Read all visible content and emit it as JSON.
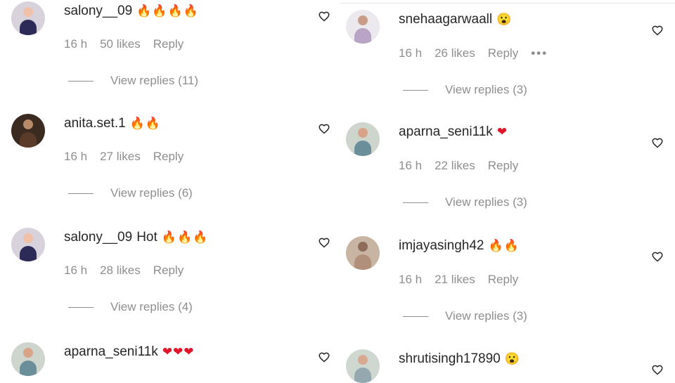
{
  "colors": {
    "username": "#262626",
    "meta": "#8e8e8e",
    "fire": "#ff6a00",
    "heart": "#e0162b",
    "emoji_face": "#f4b400"
  },
  "left_comments": [
    {
      "user": "salony__09",
      "text": "",
      "emoji": "🔥🔥🔥🔥",
      "emoji_type": "fire",
      "time": "16 h",
      "likes": "50 likes",
      "reply": "Reply",
      "view_replies": "View replies (11)",
      "avatar_colors": [
        "#d7d2dc",
        "#f0c0a8",
        "#2c2b58"
      ]
    },
    {
      "user": "anita.set.1",
      "text": "",
      "emoji": "🔥🔥",
      "emoji_type": "fire",
      "time": "16 h",
      "likes": "27 likes",
      "reply": "Reply",
      "view_replies": "View replies (6)",
      "avatar_colors": [
        "#3a2a20",
        "#b88a6a",
        "#5a3b2a"
      ]
    },
    {
      "user": "salony__09",
      "text": "Hot",
      "emoji": "🔥🔥🔥",
      "emoji_type": "fire",
      "time": "16 h",
      "likes": "28 likes",
      "reply": "Reply",
      "view_replies": "View replies (4)",
      "avatar_colors": [
        "#d7d2dc",
        "#f0c0a8",
        "#2c2b58"
      ]
    },
    {
      "user": "aparna_seni11k",
      "text": "",
      "emoji": "❤❤❤",
      "emoji_type": "heart",
      "avatar_colors": [
        "#cdd5cc",
        "#d9a38a",
        "#6a8f9a"
      ]
    }
  ],
  "right_comments": [
    {
      "user": "snehaagarwaall",
      "text": "",
      "emoji": "😮",
      "emoji_type": "wow",
      "time": "16 h",
      "likes": "26 likes",
      "reply": "Reply",
      "more": "•••",
      "view_replies": "View replies (3)",
      "avatar_colors": [
        "#ece9ee",
        "#c89c86",
        "#b8a4c4"
      ]
    },
    {
      "user": "aparna_seni11k",
      "text": "",
      "emoji": "❤",
      "emoji_type": "heart",
      "time": "16 h",
      "likes": "22 likes",
      "reply": "Reply",
      "view_replies": "View replies (3)",
      "avatar_colors": [
        "#cdd5cc",
        "#d9a38a",
        "#6a8f9a"
      ]
    },
    {
      "user": "imjayasingh42",
      "text": "",
      "emoji": "🔥🔥",
      "emoji_type": "fire",
      "time": "16 h",
      "likes": "21 likes",
      "reply": "Reply",
      "view_replies": "View replies (3)",
      "avatar_colors": [
        "#c8b4a2",
        "#8e6e5a",
        "#b0907a"
      ]
    },
    {
      "user": "shrutisingh17890",
      "text": "",
      "emoji": "😮",
      "emoji_type": "wow",
      "avatar_colors": [
        "#cfd8d0",
        "#d8a890",
        "#94a8b0"
      ]
    }
  ]
}
